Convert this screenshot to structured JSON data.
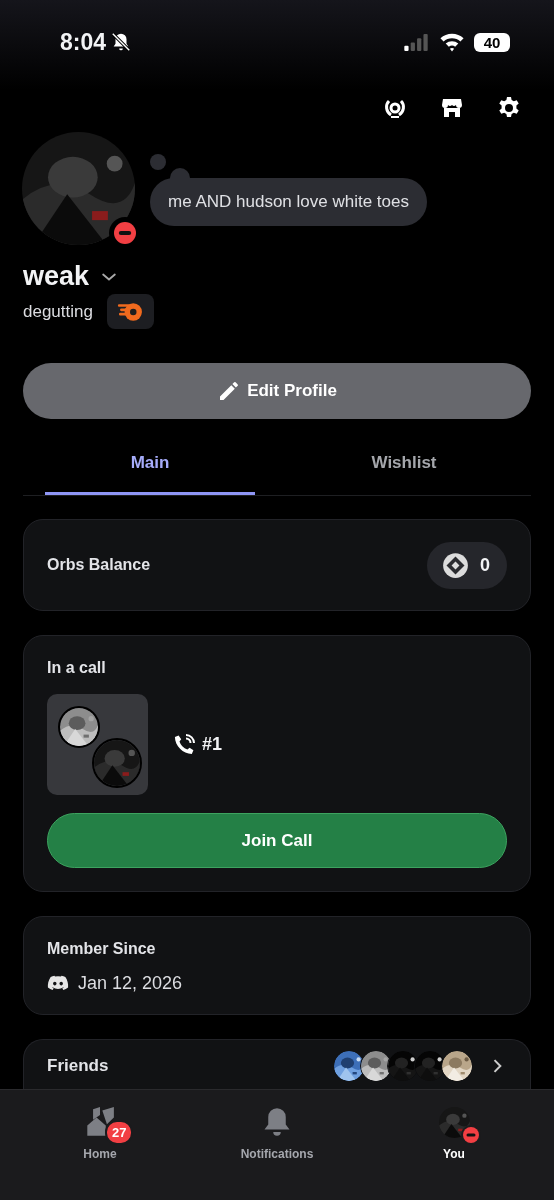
{
  "status_bar": {
    "time": "8:04",
    "battery": "40"
  },
  "profile": {
    "bio": "me AND hudson love white toes",
    "display_name": "weak",
    "username": "degutting",
    "do_not_disturb": true
  },
  "edit_button": "Edit Profile",
  "tabs": [
    {
      "label": "Main",
      "selected": true
    },
    {
      "label": "Wishlist",
      "selected": false
    }
  ],
  "orbs": {
    "label": "Orbs Balance",
    "value": "0"
  },
  "call": {
    "title": "In a call",
    "channel": "#1",
    "button": "Join Call"
  },
  "member_since": {
    "title": "Member Since",
    "date": "Jan 12, 2026"
  },
  "friends": {
    "title": "Friends"
  },
  "nav": [
    {
      "kind": "home",
      "label": "Home",
      "badge": "27",
      "selected": false
    },
    {
      "kind": "bell",
      "label": "Notifications",
      "selected": false
    },
    {
      "kind": "avatar",
      "label": "You",
      "selected": true,
      "do_not_disturb": true
    }
  ]
}
